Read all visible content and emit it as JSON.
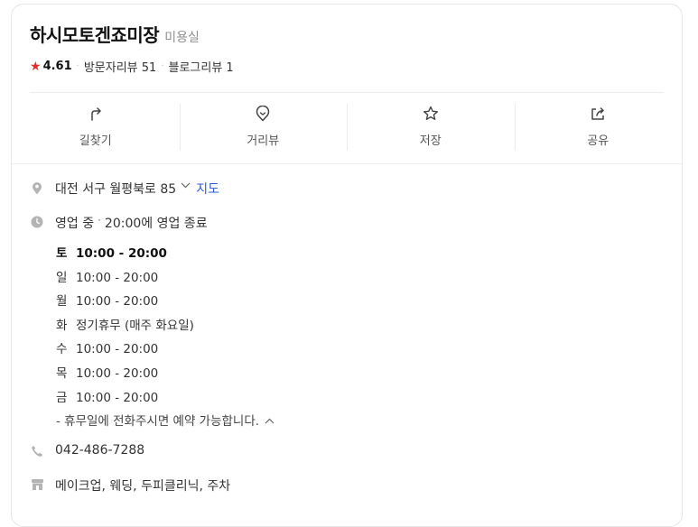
{
  "place": {
    "name": "하시모토겐죠미장",
    "category": "미용실",
    "rating": "4.61",
    "visitor_reviews": "방문자리뷰 51",
    "blog_reviews": "블로그리뷰 1",
    "star_color": "#e52b2b"
  },
  "actions": [
    {
      "label": "길찾기",
      "icon": "directions-icon"
    },
    {
      "label": "거리뷰",
      "icon": "streetview-icon"
    },
    {
      "label": "저장",
      "icon": "star-outline-icon"
    },
    {
      "label": "공유",
      "icon": "share-icon"
    }
  ],
  "address": {
    "text": "대전 서구 월평북로 85",
    "map_link": "지도"
  },
  "hours": {
    "status": "영업 중",
    "close_info": "20:00에 영업 종료",
    "days": [
      {
        "day": "토",
        "time": "10:00 - 20:00"
      },
      {
        "day": "일",
        "time": "10:00 - 20:00"
      },
      {
        "day": "월",
        "time": "10:00 - 20:00"
      },
      {
        "day": "화",
        "time": "정기휴무 (매주 화요일)"
      },
      {
        "day": "수",
        "time": "10:00 - 20:00"
      },
      {
        "day": "목",
        "time": "10:00 - 20:00"
      },
      {
        "day": "금",
        "time": "10:00 - 20:00"
      }
    ],
    "note": "- 휴무일에 전화주시면 예약 가능합니다."
  },
  "phone": "042-486-7288",
  "services": "메이크업, 웨딩, 두피클리닉, 주차",
  "colors": {
    "link": "#2a5bd7",
    "icon_gray": "#b4b4b4"
  }
}
